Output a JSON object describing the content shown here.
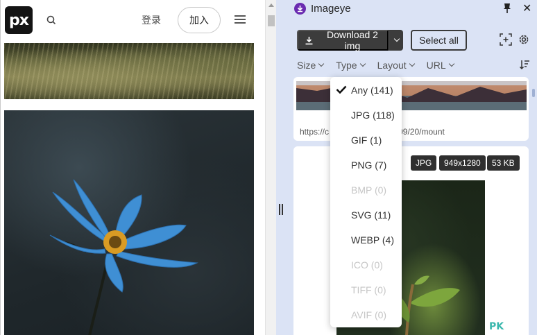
{
  "site": {
    "logo_text": "px",
    "login_label": "登录",
    "join_label": "加入"
  },
  "extension": {
    "title": "Imageye",
    "download_label": "Download 2 img",
    "select_all_label": "Select all",
    "filters": [
      {
        "label": "Size"
      },
      {
        "label": "Type"
      },
      {
        "label": "Layout"
      },
      {
        "label": "URL"
      }
    ],
    "card1_url": "https://c                    photo/2023/10/14/09/20/mount",
    "badges": [
      "JPG",
      "949x1280",
      "53 KB"
    ],
    "watermark": "PK"
  },
  "type_dropdown": {
    "options": [
      {
        "label": "Any (141)",
        "selected": true,
        "disabled": false
      },
      {
        "label": "JPG (118)",
        "selected": false,
        "disabled": false
      },
      {
        "label": "GIF (1)",
        "selected": false,
        "disabled": false
      },
      {
        "label": "PNG (7)",
        "selected": false,
        "disabled": false
      },
      {
        "label": "BMP (0)",
        "selected": false,
        "disabled": true
      },
      {
        "label": "SVG (11)",
        "selected": false,
        "disabled": false
      },
      {
        "label": "WEBP (4)",
        "selected": false,
        "disabled": false
      },
      {
        "label": "ICO (0)",
        "selected": false,
        "disabled": true
      },
      {
        "label": "TIFF (0)",
        "selected": false,
        "disabled": true
      },
      {
        "label": "AVIF (0)",
        "selected": false,
        "disabled": true
      }
    ]
  },
  "colors": {
    "panel_bg": "#dbe3f5",
    "dark_button": "#3c3c3c",
    "brand_purple": "#6a2bb0",
    "flower_blue": "#3f8fd4"
  },
  "icons": [
    "search-icon",
    "menu-icon",
    "download-icon",
    "chevron-down-icon",
    "screenshot-icon",
    "gear-icon",
    "pin-icon",
    "close-icon",
    "sort-icon",
    "check-icon"
  ]
}
